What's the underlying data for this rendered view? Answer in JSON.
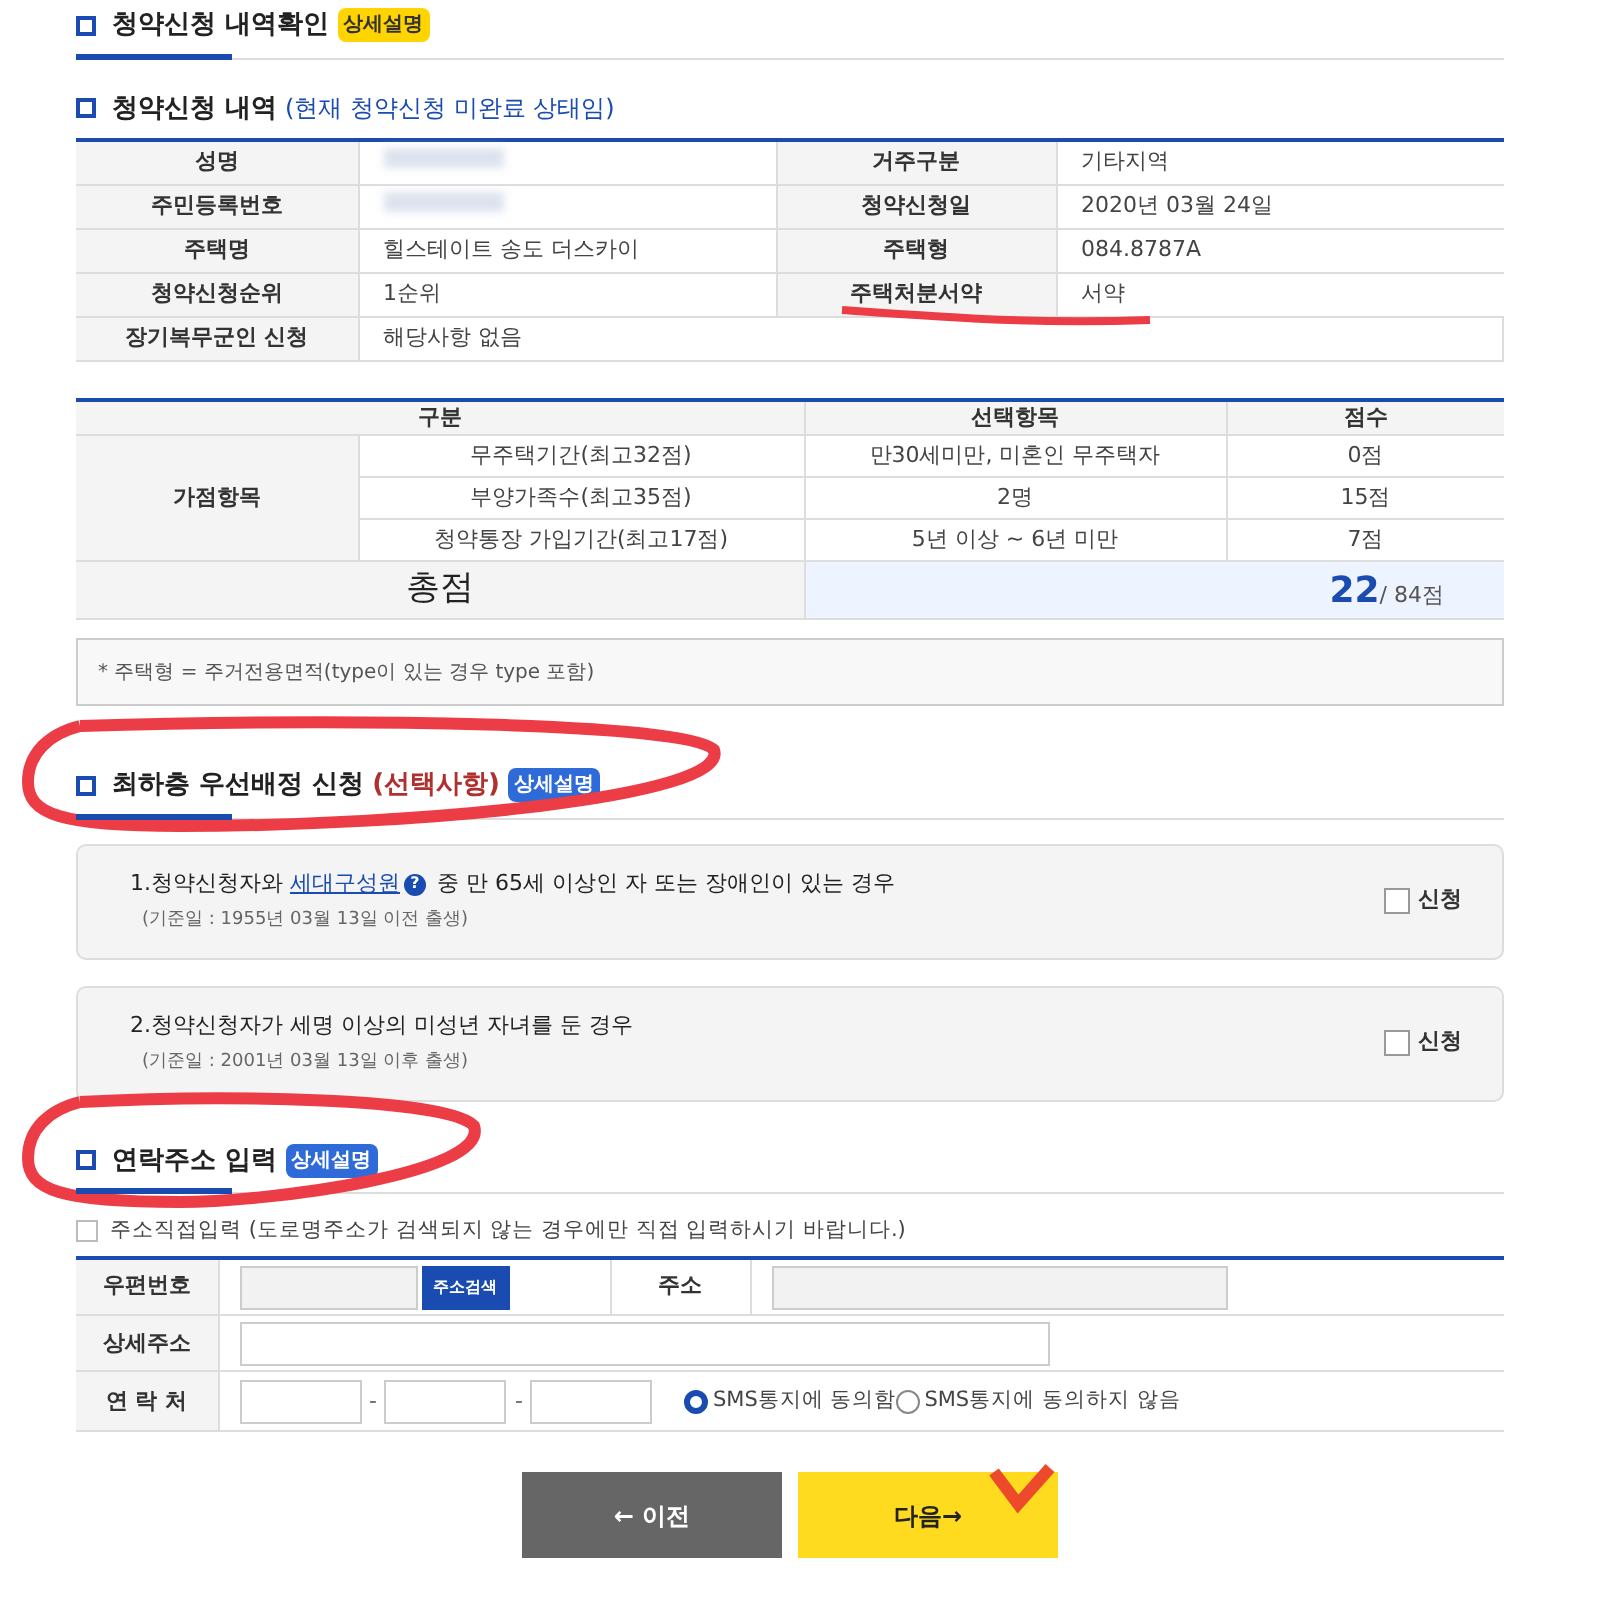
{
  "section_1": {
    "title": "청약신청 내역확인",
    "badge": "상세설명"
  },
  "application": {
    "title": "청약신청 내역",
    "status": "(현재 청약신청 미완료 상태임)",
    "rows": [
      {
        "label": "성명",
        "value_blurred": true,
        "label_2": "거주구분",
        "value_2": "기타지역"
      },
      {
        "label": "주민등록번호",
        "value_blurred": true,
        "label_2": "청약신청일",
        "value_2": "2020년 03월 24일"
      },
      {
        "label": "주택명",
        "value": "힐스테이트 송도 더스카이",
        "label_2": "주택형",
        "value_2": "084.8787A"
      },
      {
        "label": "청약신청순위",
        "value": "1순위",
        "label_2": "주택처분서약",
        "value_2": "서약"
      },
      {
        "label": "장기복무군인 신청",
        "value": "해당사항 없음"
      }
    ]
  },
  "score": {
    "columns": [
      "구분",
      "선택항목",
      "점수"
    ],
    "group": "가점항목",
    "rows": [
      {
        "item": "무주택기간(최고32점)",
        "choice": "만30세미만, 미혼인 무주택자",
        "points": "0점"
      },
      {
        "item": "부양가족수(최고35점)",
        "choice": "2명",
        "points": "15점"
      },
      {
        "item": "청약통장 가입기간(최고17점)",
        "choice": "5년 이상 ~ 6년 미만",
        "points": "7점"
      }
    ],
    "total_label": "총점",
    "total": "22",
    "total_max": "/ 84점"
  },
  "note": "* 주택형 = 주거전용면적(type이 있는 경우 type 포함)",
  "section_2": {
    "title": "최하층 우선배정 신청",
    "optional": "(선택사항)",
    "badge": "상세설명",
    "options": [
      {
        "text_before": "1.청약신청자와 ",
        "link": "세대구성원",
        "text_after": " 중 만 65세 이상인 자 또는 장애인이 있는 경우",
        "help": "?",
        "sub": "(기준일 : 1955년 03월 13일 이전 출생)",
        "check_label": "신청",
        "checked": false
      },
      {
        "text_before": "2.청약신청자가 세명 이상의 미성년 자녀를 둔 경우",
        "sub": "(기준일 : 2001년 03월 13일 이후 출생)",
        "check_label": "신청",
        "checked": false
      }
    ]
  },
  "section_3": {
    "title": "연락주소 입력",
    "badge": "상세설명",
    "direct_input": {
      "label": "주소직접입력 (도로명주소가 검색되지 않는 경우에만 직접 입력하시기 바랍니다.)",
      "checked": false
    },
    "postcode_label": "우편번호",
    "search_button": "주소검색",
    "address_label": "주소",
    "detail_label": "상세주소",
    "phone_label": "연 락 처",
    "dash": "-",
    "sms": [
      {
        "label": "SMS통지에 동의함",
        "selected": true
      },
      {
        "label": "SMS통지에 동의하지 않음",
        "selected": false
      }
    ]
  },
  "buttons": {
    "prev": "← 이전",
    "next": "다음→"
  }
}
